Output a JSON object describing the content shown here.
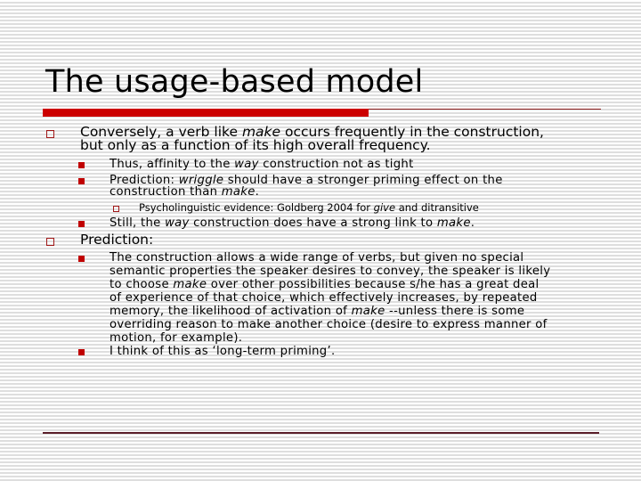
{
  "slide": {
    "title": "The usage-based model",
    "accent_color": "#cc0000",
    "line_color": "#5a1e2a"
  },
  "bullets": {
    "b1": {
      "line1_pre": "Conversely, a verb like ",
      "line1_em": "make",
      "line1_post": " occurs frequently in the construction,",
      "line2": "but only as a function of its high overall frequency."
    },
    "b1_1": {
      "pre": "Thus, affinity to the ",
      "em": "way",
      "post": " construction not as tight"
    },
    "b1_2": {
      "line1_pre": "Prediction: ",
      "line1_em": "wriggle",
      "line1_post": " should have a stronger priming effect on the",
      "line2_pre": "construction than ",
      "line2_em": "make",
      "line2_post": "."
    },
    "b1_2_1": {
      "pre": "Psycholinguistic evidence: Goldberg 2004 for ",
      "em": "give",
      "post": " and ditransitive"
    },
    "b1_3": {
      "pre": "Still, the ",
      "em1": "way",
      "mid": " construction does have a strong link to ",
      "em2": "make",
      "post": "."
    },
    "b2": {
      "text": "Prediction:"
    },
    "b2_1": {
      "line1": "The construction allows a wide range of verbs, but given no special",
      "line2": "semantic properties the speaker desires to convey, the speaker is likely",
      "line3_pre": "to choose ",
      "line3_em": "make",
      "line3_post": " over other possibilities because s/he has a great deal",
      "line4": "of experience of that choice, which effectively increases, by repeated",
      "line5_pre": "memory, the likelihood of activation of ",
      "line5_em": "make",
      "line5_post": " --unless there is some",
      "line6": "overriding reason to make another choice (desire to express manner of",
      "line7": "motion, for example)."
    },
    "b2_2": {
      "text": "I think of this as ‘long-term priming’."
    }
  }
}
